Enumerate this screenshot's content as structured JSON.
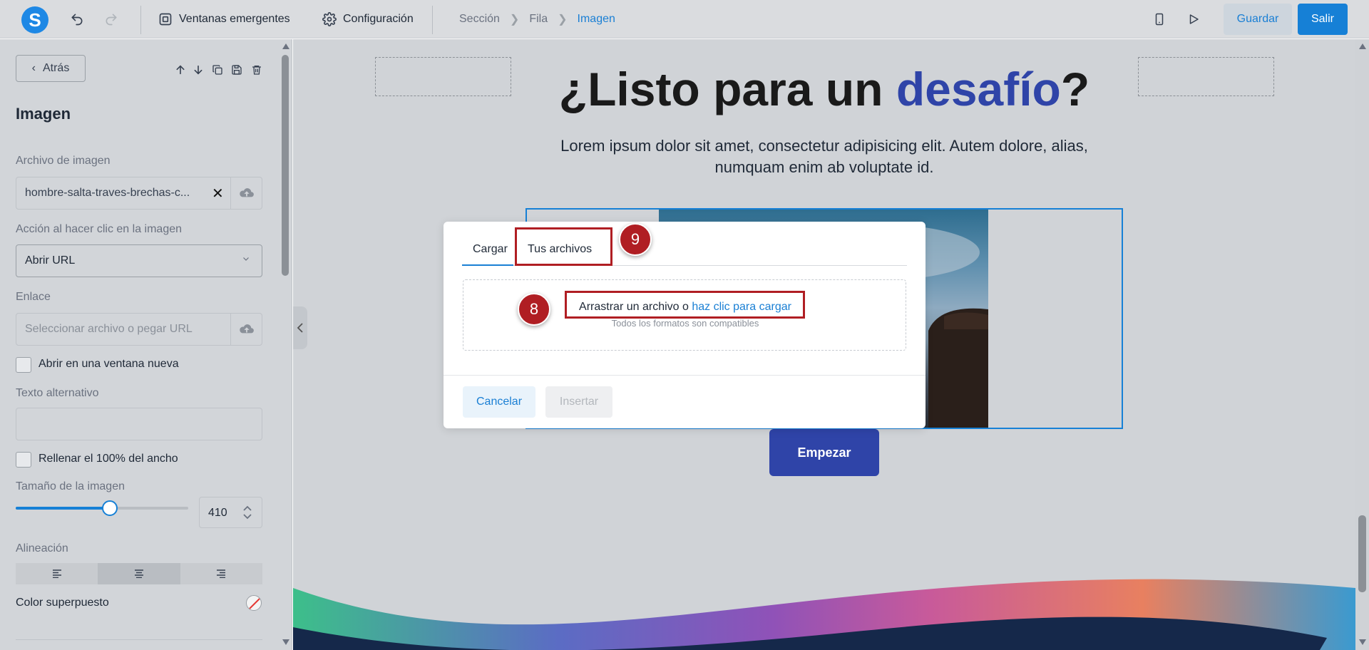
{
  "topbar": {
    "logo_letter": "S",
    "menu_popups": "Ventanas emergentes",
    "menu_config": "Configuración",
    "breadcrumb": [
      "Sección",
      "Fila",
      "Imagen"
    ],
    "save_label": "Guardar",
    "exit_label": "Salir"
  },
  "sidebar": {
    "back_label": "Atrás",
    "title": "Imagen",
    "image_file_label": "Archivo de imagen",
    "image_file_value": "hombre-salta-traves-brechas-c...",
    "click_action_label": "Acción al hacer clic en la imagen",
    "click_action_value": "Abrir URL",
    "link_label": "Enlace",
    "link_placeholder": "Seleccionar archivo o pegar URL",
    "open_new_window_label": "Abrir en una ventana nueva",
    "alt_text_label": "Texto alternativo",
    "fill_width_label": "Rellenar el 100% del ancho",
    "size_label": "Tamaño de la imagen",
    "size_value": "410",
    "size_slider_fraction": 0.55,
    "alignment_label": "Alineación",
    "alignment_selected": "center",
    "overlay_color_label": "Color superpuesto"
  },
  "canvas": {
    "title_part1": "¿Listo para un ",
    "title_highlight": "desafío",
    "title_part2": "?",
    "subtitle": "Lorem ipsum dolor sit amet, consectetur adipisicing elit. Autem dolore, alias, numquam enim ab voluptate id.",
    "cta_label": "Empezar"
  },
  "modal": {
    "tab_upload": "Cargar",
    "tab_files": "Tus archivos",
    "drop_text": "Arrastrar un archivo o ",
    "drop_link": "haz clic para cargar",
    "drop_hint": "Todos los formatos son compatibles",
    "cancel_label": "Cancelar",
    "insert_label": "Insertar"
  },
  "annotations": {
    "badge_tabs": "9",
    "badge_dropzone": "8"
  },
  "colors": {
    "accent": "#1a7fd4",
    "brand": "#2f44a8",
    "annotation": "#b01e23"
  }
}
